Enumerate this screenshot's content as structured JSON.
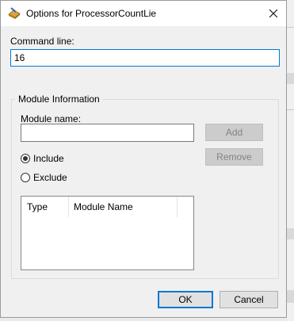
{
  "dialog": {
    "title": "Options for ProcessorCountLie",
    "command_line_label": "Command line:",
    "command_line_value": "16",
    "group_label": "Module Information",
    "module_name_label": "Module name:",
    "module_name_value": "",
    "add_label": "Add",
    "remove_label": "Remove",
    "include_label": "Include",
    "exclude_label": "Exclude",
    "selected_option": "Include",
    "columns": [
      "Type",
      "Module Name"
    ],
    "ok_label": "OK",
    "cancel_label": "Cancel"
  },
  "icons": {
    "app": "app-icon",
    "close": "close-icon"
  },
  "colors": {
    "accent": "#0078d7",
    "dialog_bg": "#f0f0f0"
  }
}
